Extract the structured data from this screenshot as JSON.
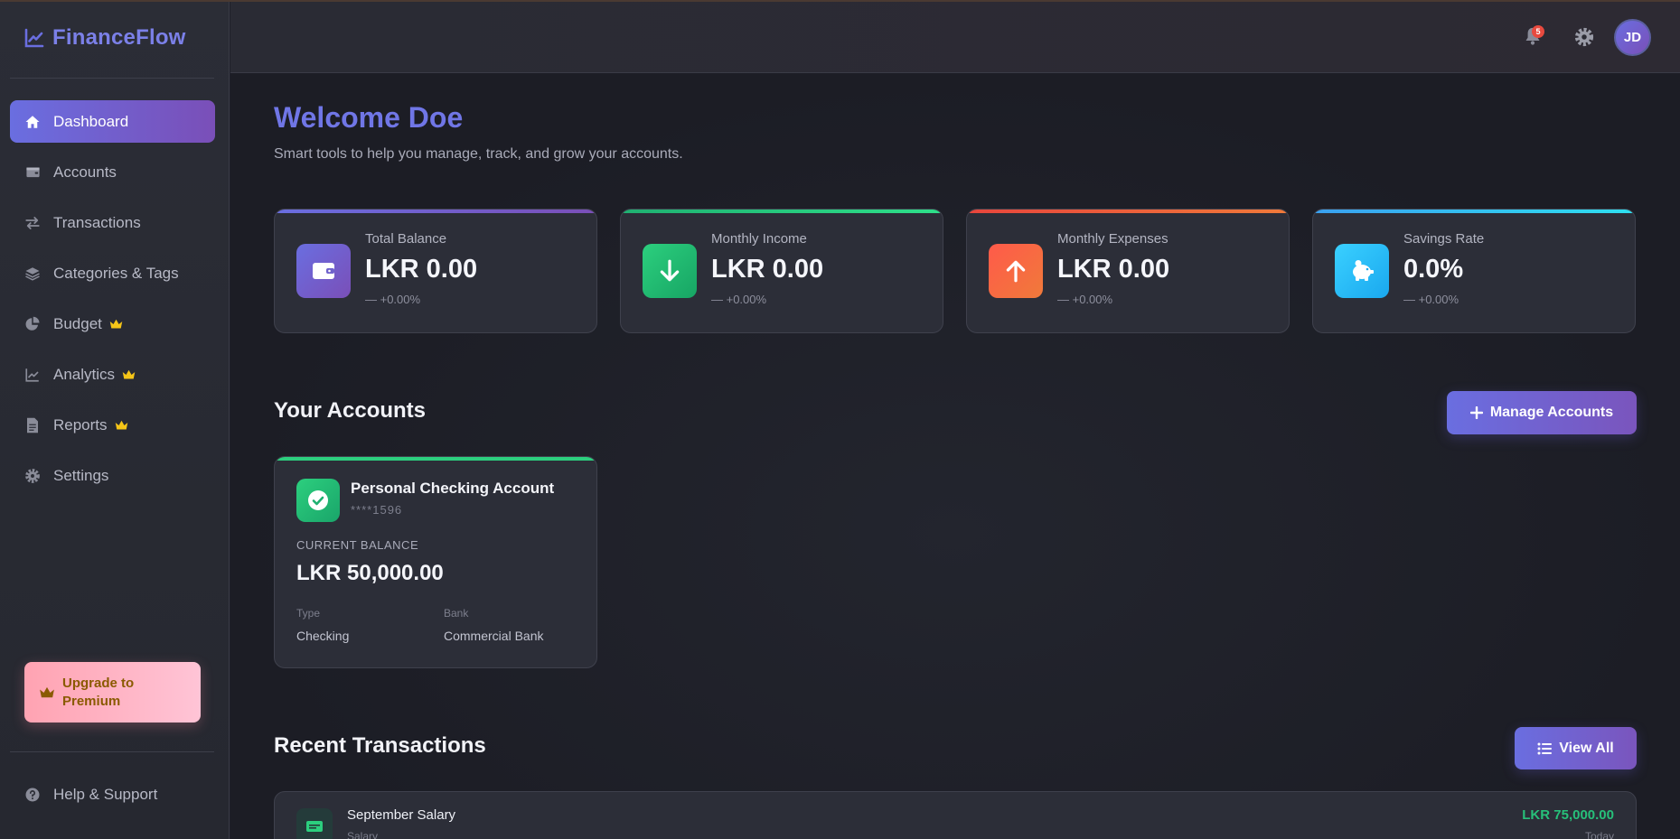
{
  "brand": {
    "name": "FinanceFlow"
  },
  "sidebar": {
    "items": [
      {
        "label": "Dashboard",
        "icon": "home-icon",
        "active": true,
        "premium": false
      },
      {
        "label": "Accounts",
        "icon": "wallet-icon",
        "active": false,
        "premium": false
      },
      {
        "label": "Transactions",
        "icon": "exchange-icon",
        "active": false,
        "premium": false
      },
      {
        "label": "Categories & Tags",
        "icon": "layers-icon",
        "active": false,
        "premium": false
      },
      {
        "label": "Budget",
        "icon": "pie-chart-icon",
        "active": false,
        "premium": true
      },
      {
        "label": "Analytics",
        "icon": "line-chart-icon",
        "active": false,
        "premium": true
      },
      {
        "label": "Reports",
        "icon": "document-icon",
        "active": false,
        "premium": true
      },
      {
        "label": "Settings",
        "icon": "gear-icon",
        "active": false,
        "premium": false
      }
    ],
    "upgrade_label": "Upgrade to Premium",
    "help_label": "Help & Support"
  },
  "header": {
    "notification_count": "5",
    "avatar_initials": "JD"
  },
  "main": {
    "welcome": "Welcome Doe",
    "subtitle": "Smart tools to help you manage, track, and grow your accounts.",
    "stats": [
      {
        "label": "Total Balance",
        "value": "LKR 0.00",
        "change": "— +0.00%",
        "icon": "wallet-icon",
        "accent": "#7b6fd8"
      },
      {
        "label": "Monthly Income",
        "value": "LKR 0.00",
        "change": "— +0.00%",
        "icon": "arrow-down-icon",
        "accent": "#2ccf7e"
      },
      {
        "label": "Monthly Expenses",
        "value": "LKR 0.00",
        "change": "— +0.00%",
        "icon": "arrow-up-icon",
        "accent": "#f06a3c"
      },
      {
        "label": "Savings Rate",
        "value": "0.0%",
        "change": "— +0.00%",
        "icon": "piggy-bank-icon",
        "accent": "#35c8f0"
      }
    ],
    "accounts_title": "Your Accounts",
    "manage_accounts_label": "Manage Accounts",
    "account": {
      "name": "Personal Checking Account",
      "number": "****1596",
      "balance_label": "CURRENT BALANCE",
      "balance": "LKR 50,000.00",
      "type_label": "Type",
      "type": "Checking",
      "bank_label": "Bank",
      "bank": "Commercial Bank"
    },
    "transactions_title": "Recent Transactions",
    "view_all_label": "View All",
    "transactions": [
      {
        "title": "September Salary",
        "subtitle": "Salary",
        "amount": "LKR 75,000.00",
        "date": "Today"
      }
    ]
  },
  "colors": {
    "accent": "#6a6ee0",
    "income": "#2ccf7e",
    "expense": "#f06a3c",
    "savings": "#35c8f0",
    "premium_crown": "#f5c518"
  }
}
